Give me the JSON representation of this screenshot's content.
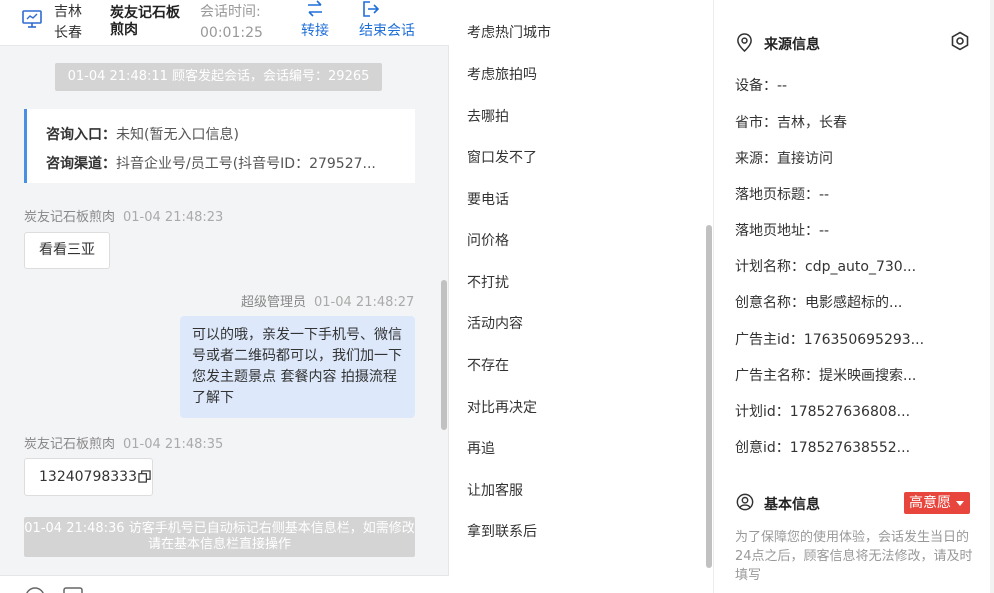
{
  "header": {
    "location": "吉林\n长春",
    "customer_name": "炭友记石板煎肉",
    "session_time_label": "会话时间:",
    "session_time_value": "00:01:25",
    "transfer_label": "转接",
    "end_label": "结束会话"
  },
  "chat": {
    "system_start": "01-04 21:48:11 顾客发起会话，会话编号：29265",
    "entry_label": "咨询入口：",
    "entry_value": "未知(暂无入口信息)",
    "channel_label": "咨询渠道：",
    "channel_value": "抖音企业号/员工号(抖音号ID：279527...",
    "messages": [
      {
        "sender": "炭友记石板煎肉",
        "time": "01-04 21:48:23",
        "text": "看看三亚"
      },
      {
        "sender": "超级管理员",
        "time": "01-04 21:48:27",
        "text": "可以的哦，亲发一下手机号、微信号或者二维码都可以，我们加一下您发主题景点 套餐内容 拍摄流程了解下"
      },
      {
        "sender": "炭友记石板煎肉",
        "time": "01-04 21:48:35",
        "text": "13240798333"
      }
    ],
    "system_end": "01-04 21:48:36 访客手机号已自动标记右侧基本信息栏，如需修改请在基本信息栏直接操作"
  },
  "quick_replies": [
    "考虑热门城市",
    "考虑旅拍吗",
    "去哪拍",
    "窗口发不了",
    "要电话",
    "问价格",
    "不打扰",
    "活动内容",
    "不存在",
    "对比再决定",
    "再追",
    "让加客服",
    "拿到联系后"
  ],
  "source_info": {
    "title": "来源信息",
    "fields": [
      {
        "label": "设备：",
        "value": "--"
      },
      {
        "label": "省市：",
        "value": "吉林，长春"
      },
      {
        "label": "来源：",
        "value": "直接访问"
      },
      {
        "label": "落地页标题：",
        "value": "--"
      },
      {
        "label": "落地页地址：",
        "value": "--"
      },
      {
        "label": "计划名称：",
        "value": "cdp_auto_730..."
      },
      {
        "label": "创意名称：",
        "value": "电影感超标的..."
      },
      {
        "label": "广告主id：",
        "value": "176350695293..."
      },
      {
        "label": "广告主名称：",
        "value": "提米映画搜索..."
      },
      {
        "label": "计划id：",
        "value": "178527636808..."
      },
      {
        "label": "创意id：",
        "value": "178527638552..."
      }
    ]
  },
  "basic_info": {
    "title": "基本信息",
    "intent_badge": "高意愿",
    "note": "为了保障您的使用体验，会话发生当日的24点之后，顾客信息将无法修改，请及时填写"
  },
  "colors": {
    "accent": "#1f6fd9",
    "badge": "#e8453c",
    "bubble": "#dde9fb"
  }
}
